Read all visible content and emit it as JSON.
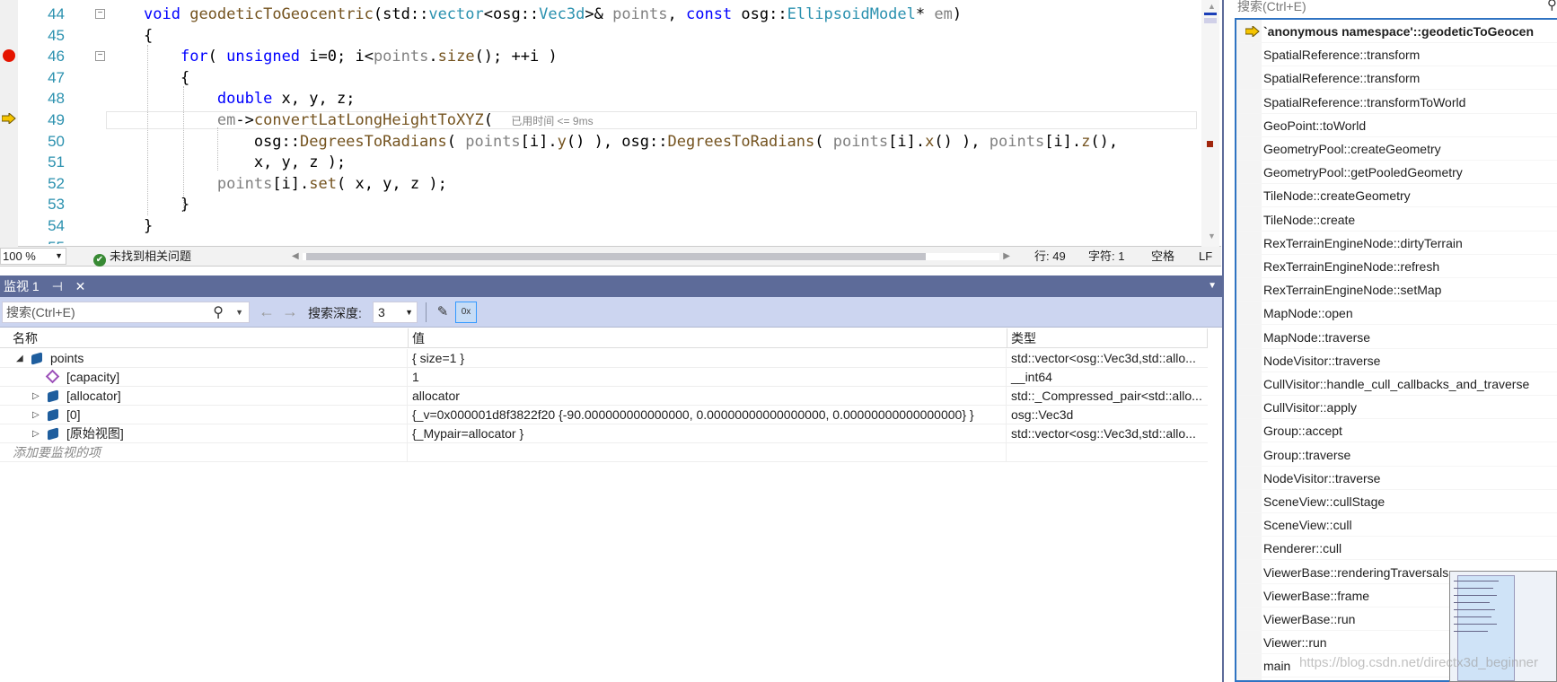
{
  "editor": {
    "lines": [
      {
        "num": "44",
        "segs": [
          [
            "kw",
            "void"
          ],
          [
            "t",
            " "
          ],
          [
            "fn",
            "geodeticToGeocentric"
          ],
          [
            "t",
            "(std::"
          ],
          [
            "ty",
            "vector"
          ],
          [
            "t",
            "<osg::"
          ],
          [
            "ty",
            "Vec3d"
          ],
          [
            "t",
            ">& "
          ],
          [
            "pm",
            "points"
          ],
          [
            "t",
            ", "
          ],
          [
            "kw",
            "const"
          ],
          [
            "t",
            " osg::"
          ],
          [
            "ty",
            "EllipsoidModel"
          ],
          [
            "t",
            "* "
          ],
          [
            "pm",
            "em"
          ],
          [
            "t",
            ")"
          ]
        ]
      },
      {
        "num": "45",
        "segs": [
          [
            "t",
            "{"
          ]
        ]
      },
      {
        "num": "46",
        "segs": [
          [
            "t",
            "    "
          ],
          [
            "kw",
            "for"
          ],
          [
            "t",
            "( "
          ],
          [
            "kw",
            "unsigned"
          ],
          [
            "t",
            " i=0; i<"
          ],
          [
            "pm",
            "points"
          ],
          [
            "t",
            "."
          ],
          [
            "fn",
            "size"
          ],
          [
            "t",
            "(); ++i )"
          ]
        ]
      },
      {
        "num": "47",
        "segs": [
          [
            "t",
            "    {"
          ]
        ]
      },
      {
        "num": "48",
        "segs": [
          [
            "t",
            "        "
          ],
          [
            "kw",
            "double"
          ],
          [
            "t",
            " x, y, z;"
          ]
        ]
      },
      {
        "num": "49",
        "segs": [
          [
            "t",
            "        "
          ],
          [
            "pm",
            "em"
          ],
          [
            "t",
            "->"
          ],
          [
            "fn",
            "convertLatLongHeightToXYZ"
          ],
          [
            "t",
            "( "
          ]
        ]
      },
      {
        "num": "50",
        "segs": [
          [
            "t",
            "            osg::"
          ],
          [
            "fn",
            "DegreesToRadians"
          ],
          [
            "t",
            "( "
          ],
          [
            "pm",
            "points"
          ],
          [
            "t",
            "[i]."
          ],
          [
            "fn",
            "y"
          ],
          [
            "t",
            "() ), osg::"
          ],
          [
            "fn",
            "DegreesToRadians"
          ],
          [
            "t",
            "( "
          ],
          [
            "pm",
            "points"
          ],
          [
            "t",
            "[i]."
          ],
          [
            "fn",
            "x"
          ],
          [
            "t",
            "() ), "
          ],
          [
            "pm",
            "points"
          ],
          [
            "t",
            "[i]."
          ],
          [
            "fn",
            "z"
          ],
          [
            "t",
            "(),"
          ]
        ]
      },
      {
        "num": "51",
        "segs": [
          [
            "t",
            "            x, y, z );"
          ]
        ]
      },
      {
        "num": "52",
        "segs": [
          [
            "t",
            "        "
          ],
          [
            "pm",
            "points"
          ],
          [
            "t",
            "[i]."
          ],
          [
            "fn",
            "set"
          ],
          [
            "t",
            "( x, y, z );"
          ]
        ]
      },
      {
        "num": "53",
        "segs": [
          [
            "t",
            "    }"
          ]
        ]
      },
      {
        "num": "54",
        "segs": [
          [
            "t",
            "}"
          ]
        ]
      }
    ],
    "elapsed": "已用时间 <= 9ms",
    "partial_line_num": "55"
  },
  "status": {
    "zoom": "100 %",
    "issues": "未找到相关问题",
    "line": "行: 49",
    "char": "字符: 1",
    "whitespace": "空格",
    "eol": "LF"
  },
  "watch": {
    "tab_title": "监视 1",
    "search_placeholder": "搜索(Ctrl+E)",
    "depth_label": "搜索深度:",
    "depth_value": "3",
    "hex_label": "0x",
    "columns": {
      "name": "名称",
      "value": "值",
      "type": "类型"
    },
    "rows": [
      {
        "name": "points",
        "value": "{ size=1 }",
        "type": "std::vector<osg::Vec3d,std::allo...",
        "level": 0,
        "expander": "◢",
        "icon": "obj"
      },
      {
        "name": "[capacity]",
        "value": "1",
        "type": "__int64",
        "level": 1,
        "expander": "",
        "icon": "pur"
      },
      {
        "name": "[allocator]",
        "value": "allocator",
        "type": "std::_Compressed_pair<std::allo...",
        "level": 1,
        "expander": "▷",
        "icon": "obj"
      },
      {
        "name": "[0]",
        "value": "{_v=0x000001d8f3822f20 {-90.000000000000000, 0.00000000000000000, 0.00000000000000000} }",
        "type": "osg::Vec3d",
        "level": 1,
        "expander": "▷",
        "icon": "obj"
      },
      {
        "name": "[原始视图]",
        "value": "{_Mypair=allocator }",
        "type": "std::vector<osg::Vec3d,std::allo...",
        "level": 1,
        "expander": "▷",
        "icon": "obj"
      }
    ],
    "add_watch": "添加要监视的项"
  },
  "callstack": {
    "search_placeholder": "搜索(Ctrl+E)",
    "frames": [
      "`anonymous namespace'::geodeticToGeocen",
      "SpatialReference::transform",
      "SpatialReference::transform",
      "SpatialReference::transformToWorld",
      "GeoPoint::toWorld",
      "GeometryPool::createGeometry",
      "GeometryPool::getPooledGeometry",
      "TileNode::createGeometry",
      "TileNode::create",
      "RexTerrainEngineNode::dirtyTerrain",
      "RexTerrainEngineNode::refresh",
      "RexTerrainEngineNode::setMap",
      "MapNode::open",
      "MapNode::traverse",
      "NodeVisitor::traverse",
      "CullVisitor::handle_cull_callbacks_and_traverse",
      "CullVisitor::apply",
      "Group::accept",
      "Group::traverse",
      "NodeVisitor::traverse",
      "SceneView::cullStage",
      "SceneView::cull",
      "Renderer::cull",
      "ViewerBase::renderingTraversals",
      "ViewerBase::frame",
      "ViewerBase::run",
      "Viewer::run",
      "main"
    ]
  },
  "watermark": "https://blog.csdn.net/directx3d_beginner",
  "colors": {
    "breakpoint": "#e51400",
    "arrow": "#f5c400",
    "title_bar": "#5d6b99",
    "toolbar": "#ccd5f0"
  }
}
